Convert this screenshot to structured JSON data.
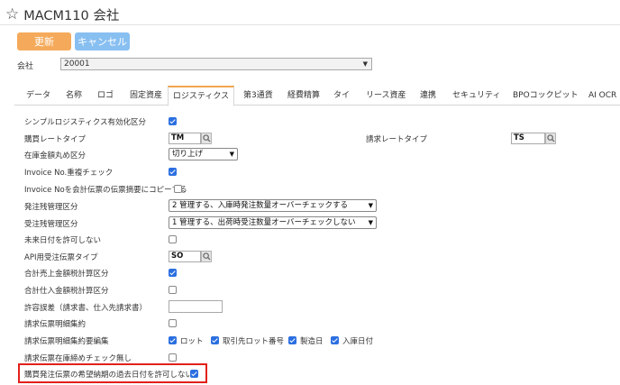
{
  "header": {
    "title": "MACM110 会社",
    "update_label": "更新",
    "cancel_label": "キャンセル"
  },
  "company": {
    "label": "会社",
    "value": "20001"
  },
  "tabs": [
    {
      "label": "データ"
    },
    {
      "label": "名称"
    },
    {
      "label": "ロゴ"
    },
    {
      "label": "固定資産"
    },
    {
      "label": "ロジスティクス"
    },
    {
      "label": "第3通貨"
    },
    {
      "label": "経費精算"
    },
    {
      "label": "タイ"
    },
    {
      "label": "リース資産"
    },
    {
      "label": "連携"
    },
    {
      "label": "セキュリティ"
    },
    {
      "label": "BPOコックピット"
    },
    {
      "label": "AI OCR"
    }
  ],
  "active_tab": "ロジスティクス",
  "form": {
    "simple_logistics": {
      "label": "シンプルロジスティクス有効化区分",
      "checked": true
    },
    "purchase_rate_type": {
      "label": "購買レートタイプ",
      "value": "TM"
    },
    "billing_rate_type": {
      "label": "請求レートタイプ",
      "value": "TS"
    },
    "inventory_rounding": {
      "label": "在庫金額丸め区分",
      "value": "切り上げ"
    },
    "invoice_dup_check": {
      "label": "Invoice No.重複チェック",
      "checked": true
    },
    "invoice_copy": {
      "label": "Invoice Noを会計伝票の伝票摘要にコピーする",
      "checked": false
    },
    "order_balance": {
      "label": "発注残管理区分",
      "value": "2 管理する、入庫時発注数量オーバーチェックする"
    },
    "received_balance": {
      "label": "受注残管理区分",
      "value": "1 管理する、出荷時受注数量オーバーチェックしない"
    },
    "no_future_date": {
      "label": "未来日付を許可しない",
      "checked": false
    },
    "api_order_type": {
      "label": "API用受注伝票タイプ",
      "value": "SO"
    },
    "total_sales_tax": {
      "label": "合計売上金額税計算区分",
      "checked": true
    },
    "total_purchase_tax": {
      "label": "合計仕入金額税計算区分",
      "checked": false
    },
    "tolerance": {
      "label": "許容誤差（請求書、仕入先請求書）",
      "value": ""
    },
    "billing_detail_summary": {
      "label": "請求伝票明細集約",
      "checked": false
    },
    "billing_detail_summary_edit": {
      "label": "請求伝票明細集約要編集",
      "options": [
        {
          "label": "ロット",
          "checked": true
        },
        {
          "label": "取引先ロット番号",
          "checked": true
        },
        {
          "label": "製造日",
          "checked": true
        },
        {
          "label": "入庫日付",
          "checked": true
        }
      ]
    },
    "no_inventory_close_check": {
      "label": "請求伝票在庫締めチェック無し",
      "checked": false
    },
    "no_past_desired_date": {
      "label": "購買発注伝票の希望納期の過去日付を許可しない",
      "checked": true
    }
  },
  "colors": {
    "update_button": "#f5aa5b",
    "cancel_button": "#88bff1",
    "active_tab_accent": "#f0a64f",
    "checkbox_checked": "#2b6fe0",
    "highlight_border": "#e3201b"
  }
}
